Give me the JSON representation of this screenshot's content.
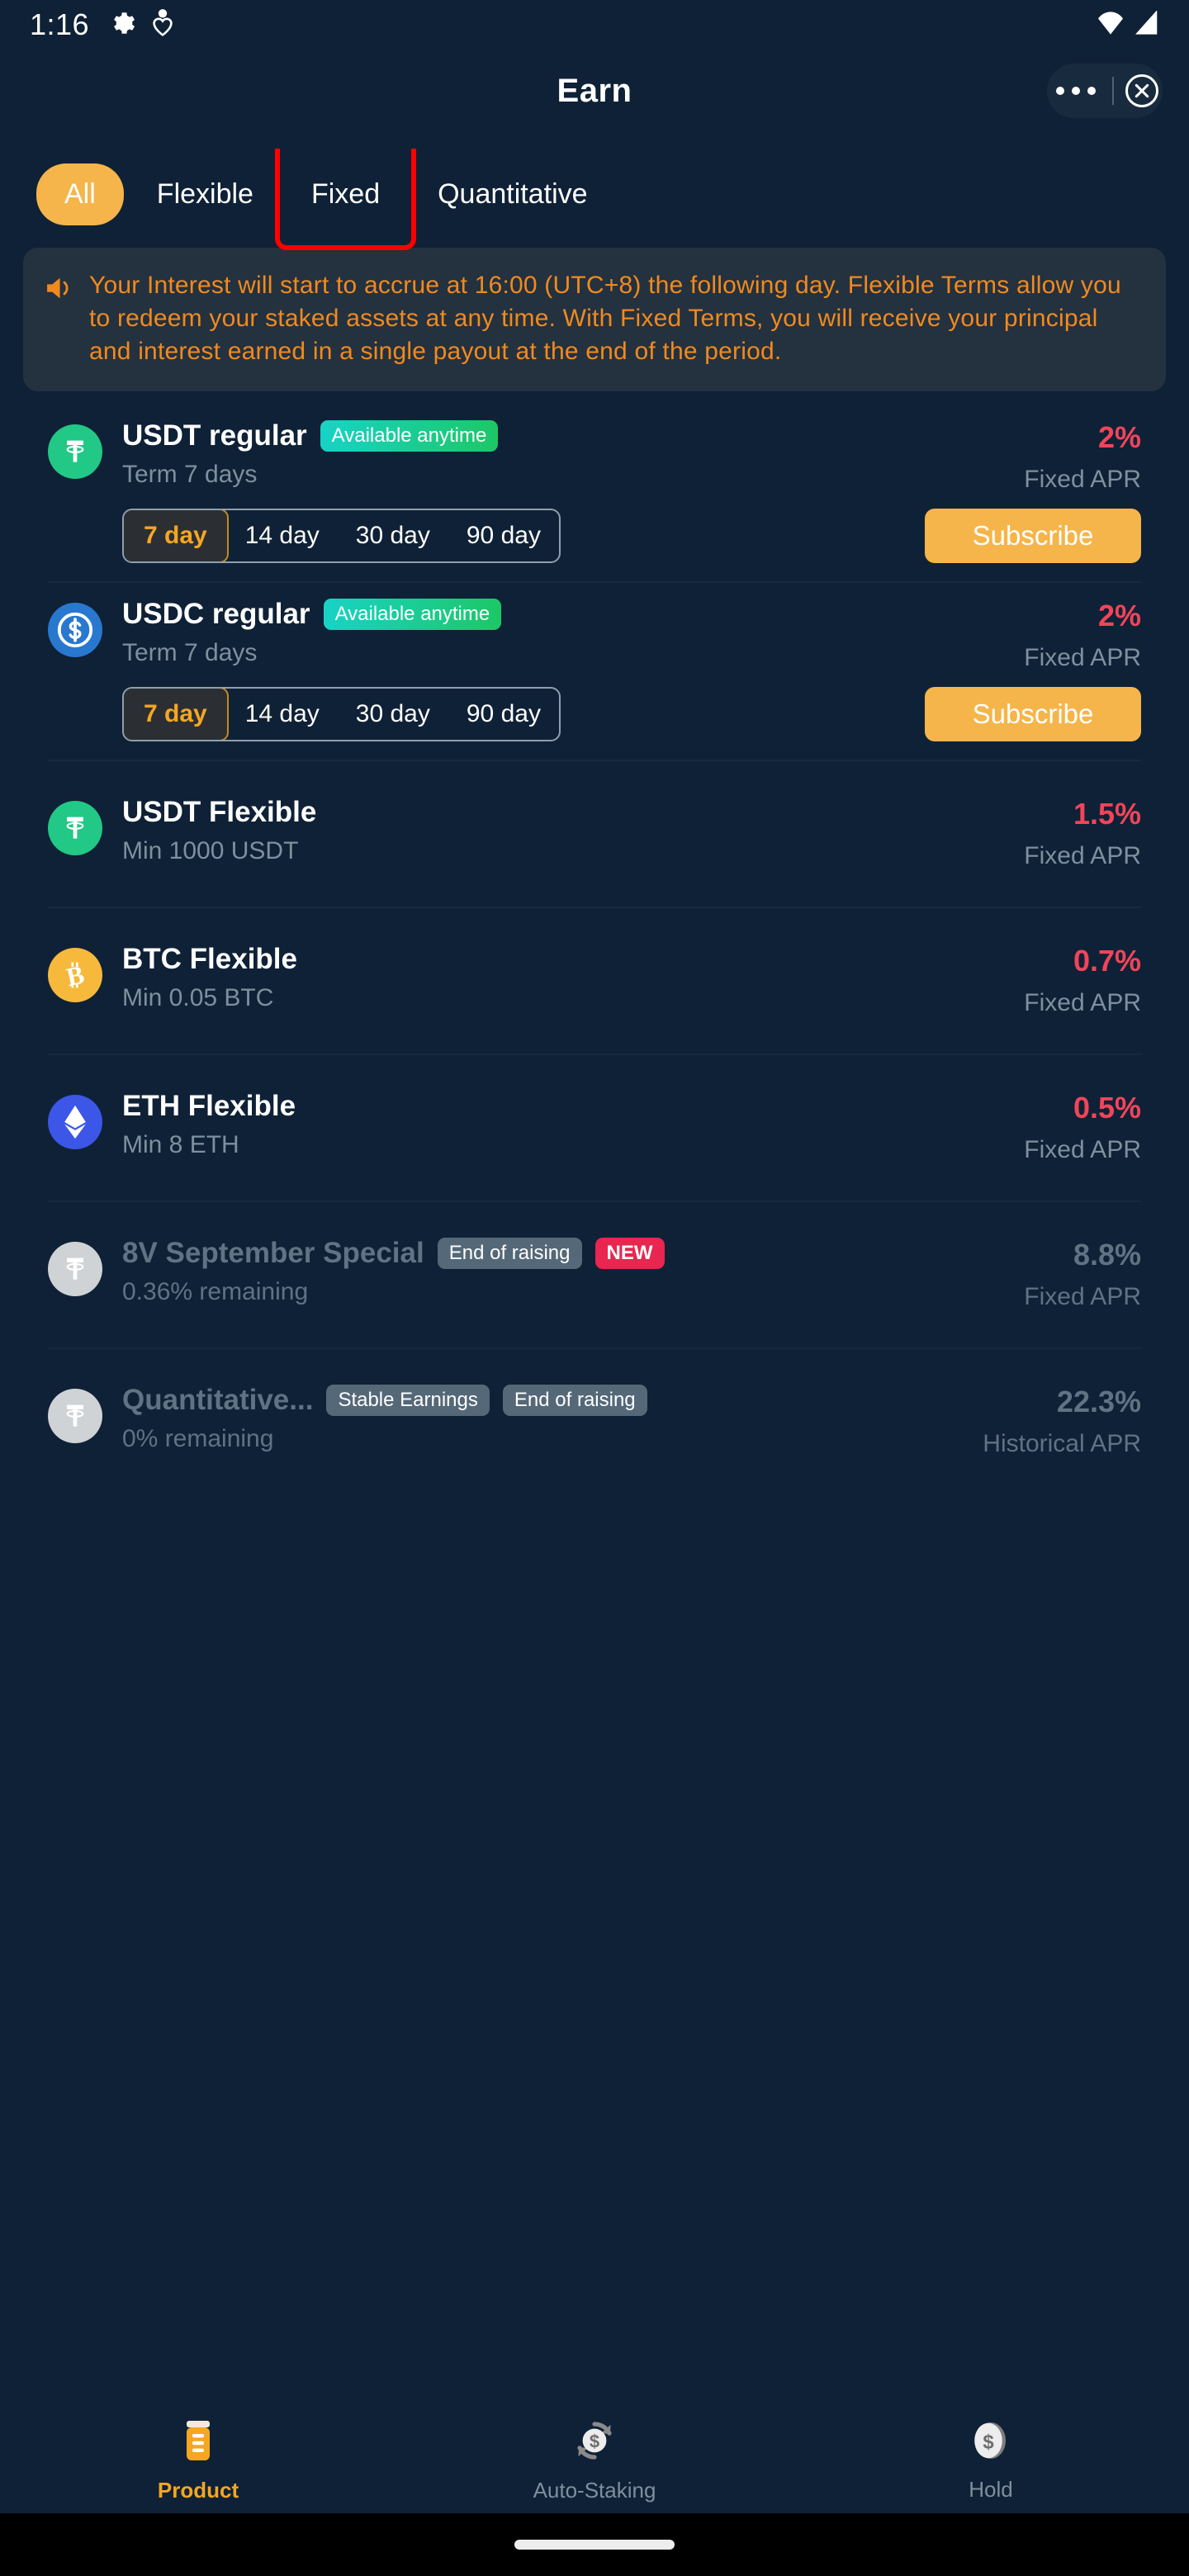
{
  "status_bar": {
    "time": "1:16",
    "icons_left": [
      "gear-icon",
      "health-icon"
    ],
    "icons_right": [
      "wifi-icon",
      "signal-icon"
    ]
  },
  "header": {
    "title": "Earn",
    "menu_icon": "more-dots-icon",
    "close_icon": "close-circle-icon"
  },
  "tabs": [
    {
      "label": "All",
      "active": true
    },
    {
      "label": "Flexible",
      "active": false
    },
    {
      "label": "Fixed",
      "active": false,
      "highlighted": true
    },
    {
      "label": "Quantitative",
      "active": false
    }
  ],
  "notice": {
    "icon": "megaphone-icon",
    "text": "Your Interest will start to accrue at 16:00 (UTC+8) the following day. Flexible Terms allow you to redeem your staked assets at any time. With Fixed Terms, you will receive your principal and interest earned in a single payout at the end of the period."
  },
  "products": [
    {
      "coin": "usdt",
      "coin_icon": "tether-icon",
      "title": "USDT regular",
      "badges": [
        {
          "text": "Available anytime",
          "style": "avail"
        }
      ],
      "subtitle": "Term 7 days",
      "apr": "2%",
      "apr_label": "Fixed APR",
      "terms": [
        "7 day",
        "14 day",
        "30 day",
        "90 day"
      ],
      "selected_term": "7 day",
      "action": "Subscribe",
      "disabled": false
    },
    {
      "coin": "usdc",
      "coin_icon": "usdc-icon",
      "title": "USDC regular",
      "badges": [
        {
          "text": "Available anytime",
          "style": "avail"
        }
      ],
      "subtitle": "Term 7 days",
      "apr": "2%",
      "apr_label": "Fixed APR",
      "terms": [
        "7 day",
        "14 day",
        "30 day",
        "90 day"
      ],
      "selected_term": "7 day",
      "action": "Subscribe",
      "disabled": false
    },
    {
      "coin": "usdt",
      "coin_icon": "tether-icon",
      "title": "USDT Flexible",
      "badges": [],
      "subtitle": "Min 1000 USDT",
      "apr": "1.5%",
      "apr_label": "Fixed APR",
      "terms": [],
      "selected_term": "",
      "action": "",
      "disabled": false
    },
    {
      "coin": "btc",
      "coin_icon": "bitcoin-icon",
      "title": "BTC Flexible",
      "badges": [],
      "subtitle": "Min 0.05 BTC",
      "apr": "0.7%",
      "apr_label": "Fixed APR",
      "terms": [],
      "selected_term": "",
      "action": "",
      "disabled": false
    },
    {
      "coin": "eth",
      "coin_icon": "ethereum-icon",
      "title": "ETH Flexible",
      "badges": [],
      "subtitle": "Min 8 ETH",
      "apr": "0.5%",
      "apr_label": "Fixed APR",
      "terms": [],
      "selected_term": "",
      "action": "",
      "disabled": false
    },
    {
      "coin": "grey",
      "coin_icon": "tether-icon",
      "title": "8V September Special",
      "badges": [
        {
          "text": "End of raising",
          "style": "grey"
        },
        {
          "text": "NEW",
          "style": "new"
        }
      ],
      "subtitle": "0.36% remaining",
      "apr": "8.8%",
      "apr_label": "Fixed APR",
      "terms": [],
      "selected_term": "",
      "action": "",
      "disabled": true
    },
    {
      "coin": "grey",
      "coin_icon": "tether-icon",
      "title": "Quantitative...",
      "badges": [
        {
          "text": "Stable Earnings",
          "style": "grey"
        },
        {
          "text": "End of raising",
          "style": "grey"
        }
      ],
      "subtitle": "0% remaining",
      "apr": "22.3%",
      "apr_label": "Historical APR",
      "terms": [],
      "selected_term": "",
      "action": "",
      "disabled": true
    }
  ],
  "bottom_nav": [
    {
      "label": "Product",
      "icon": "product-icon",
      "active": true
    },
    {
      "label": "Auto-Staking",
      "icon": "auto-staking-icon",
      "active": false
    },
    {
      "label": "Hold",
      "icon": "hold-coin-icon",
      "active": false
    }
  ],
  "colors": {
    "background": "#0F2136",
    "accent": "#F5B54A",
    "apr": "#F0455A",
    "notice_text": "#F08A1E",
    "badge_new": "#E8264F",
    "highlight_box": "#FF0000"
  }
}
